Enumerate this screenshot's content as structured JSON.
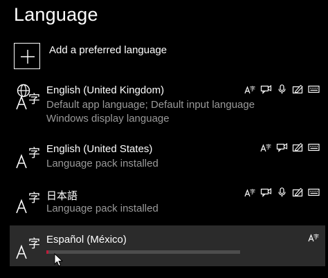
{
  "page": {
    "title": "Language"
  },
  "add_language": {
    "label": "Add a preferred language"
  },
  "languages": [
    {
      "name": "English (United Kingdom)",
      "line1": "Default app language; Default input language",
      "line2": "Windows display language",
      "features": [
        "text-to-speech-icon",
        "speech-icon",
        "microphone-icon",
        "handwriting-icon",
        "keyboard-icon"
      ]
    },
    {
      "name": "English (United States)",
      "line1": "Language pack installed",
      "features": [
        "text-to-speech-icon",
        "speech-icon",
        "handwriting-icon",
        "keyboard-icon"
      ]
    },
    {
      "name": "日本語",
      "line1": "Language pack installed",
      "features": [
        "text-to-speech-icon",
        "speech-icon",
        "microphone-icon",
        "handwriting-icon",
        "keyboard-icon"
      ]
    },
    {
      "name": "Español (México)",
      "features": [
        "text-to-speech-icon"
      ],
      "progress": 0.01
    }
  ],
  "colors": {
    "background": "#000000",
    "selected_row": "#2b2b2b",
    "secondary_text": "#9a9a9a",
    "progress_fill": "#c01b3a",
    "progress_track": "#4d4d4d"
  }
}
